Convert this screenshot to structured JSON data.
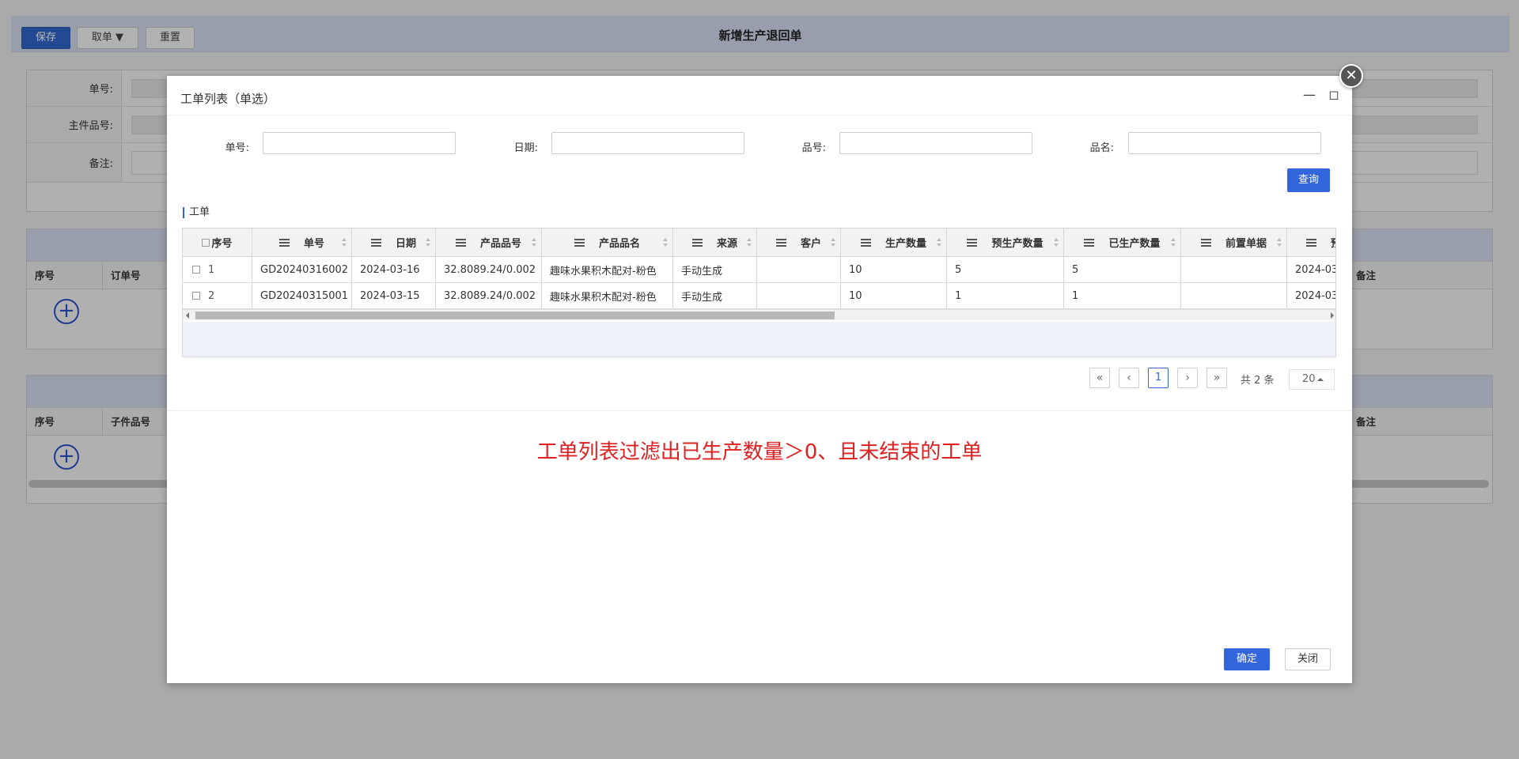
{
  "background": {
    "toolbar": {
      "save_label": "保存",
      "fetch_label": "取单 ▼",
      "reset_label": "重置"
    },
    "page_title": "新增生产退回单",
    "form": {
      "order_no_label": "单号:",
      "main_part_label": "主件品号:",
      "remark_label": "备注:"
    },
    "table1": {
      "col_seq": "序号",
      "col_order": "订单号",
      "col_remark": "备注"
    },
    "table2": {
      "col_seq": "序号",
      "col_child": "子件品号",
      "col_remark": "备注"
    }
  },
  "modal": {
    "title": "工单列表（单选）",
    "search": {
      "order_no_label": "单号:",
      "date_label": "日期:",
      "part_no_label": "品号:",
      "part_name_label": "品名:",
      "query_label": "查询"
    },
    "section_label": "工单",
    "grid": {
      "headers": [
        "序号",
        "单号",
        "日期",
        "产品品号",
        "产品品名",
        "来源",
        "客户",
        "生产数量",
        "预生产数量",
        "已生产数量",
        "前置单据",
        "预"
      ],
      "rows": [
        {
          "seq": "1",
          "order_no": "GD20240316002",
          "date": "2024-03-16",
          "part_no": "32.8089.24/0.002",
          "part_name": "趣味水果积木配对-粉色",
          "source": "手动生成",
          "customer": "",
          "qty": "10",
          "pre_qty": "5",
          "done_qty": "5",
          "prev_doc": "",
          "next": "2024-03"
        },
        {
          "seq": "2",
          "order_no": "GD20240315001",
          "date": "2024-03-15",
          "part_no": "32.8089.24/0.002",
          "part_name": "趣味水果积木配对-粉色",
          "source": "手动生成",
          "customer": "",
          "qty": "10",
          "pre_qty": "1",
          "done_qty": "1",
          "prev_doc": "",
          "next": "2024-03"
        }
      ]
    },
    "pager": {
      "first": "«",
      "prev": "‹",
      "current": "1",
      "next": "›",
      "last": "»",
      "total": "共 2 条",
      "page_size": "20"
    },
    "annotation": "工单列表过滤出已生产数量＞0、且未结束的工单",
    "footer": {
      "ok_label": "确定",
      "close_label": "关闭"
    }
  }
}
